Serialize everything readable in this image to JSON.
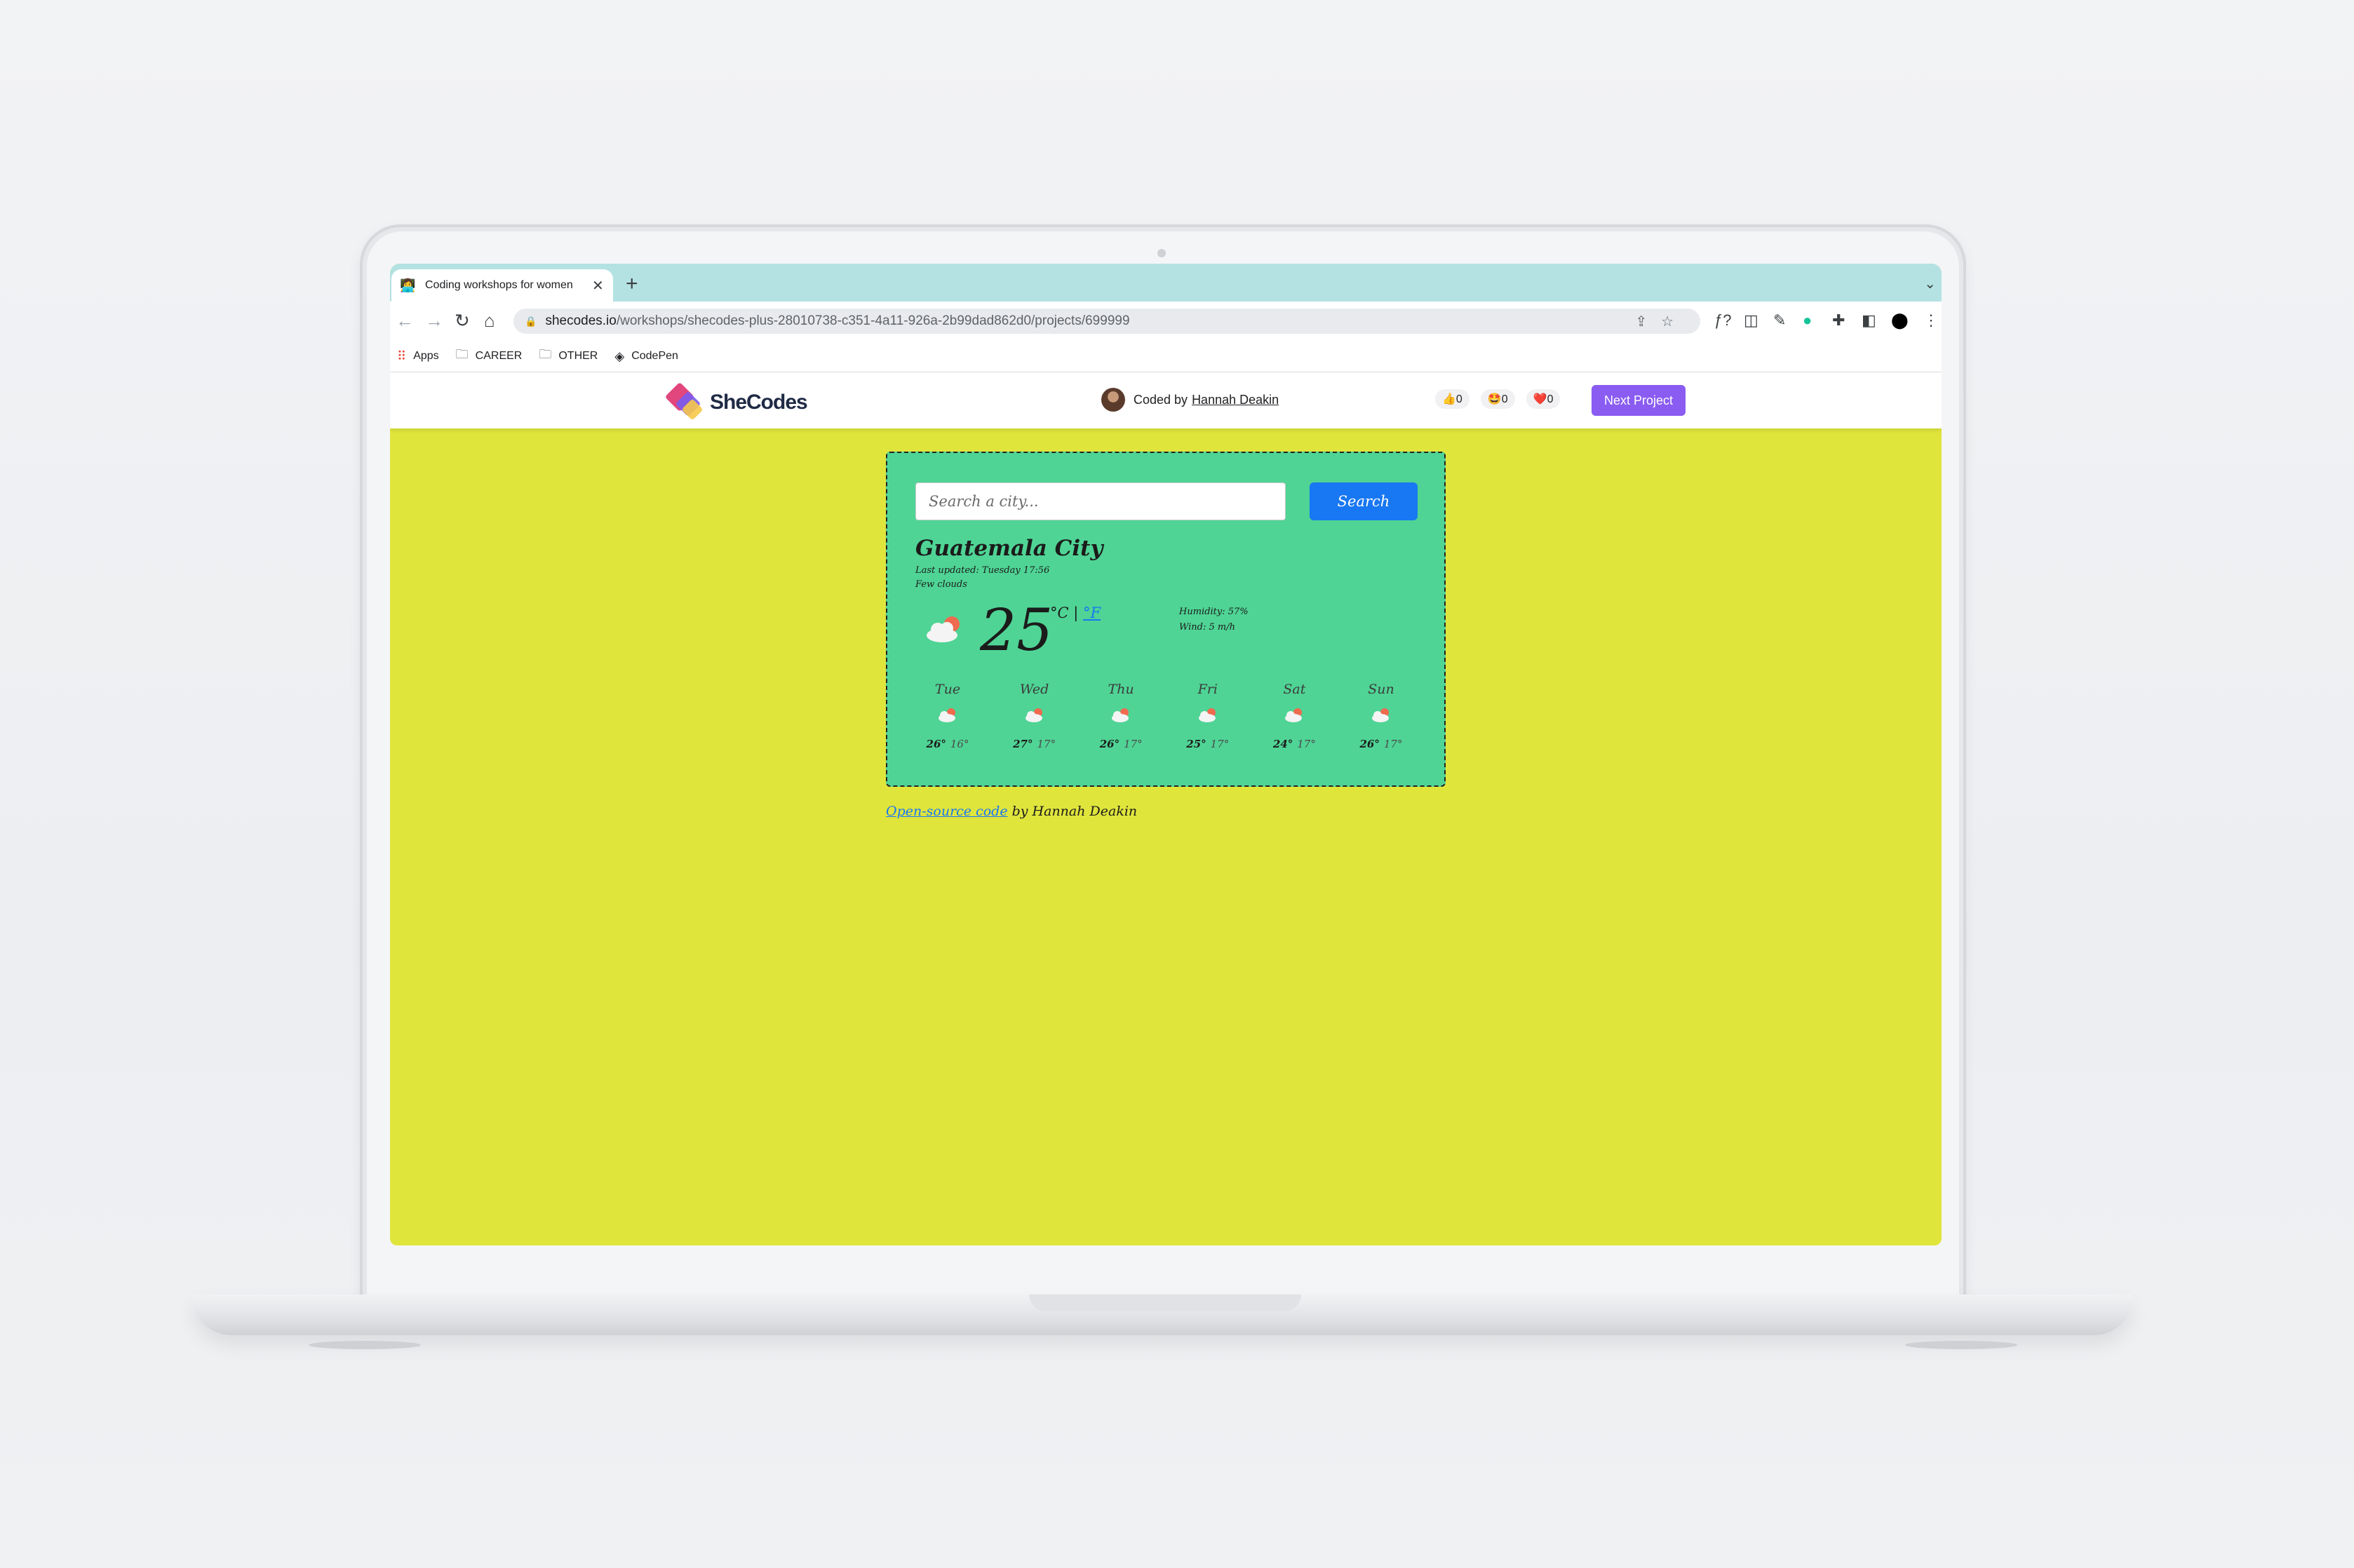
{
  "browser": {
    "tab_title": "Coding workshops for women",
    "url_domain": "shecodes.io",
    "url_path": "/workshops/shecodes-plus-28010738-c351-4a11-926a-2b99dad862d0/projects/699999",
    "bookmarks": [
      {
        "label": "Apps",
        "icon": "apps-grid-icon"
      },
      {
        "label": "CAREER",
        "icon": "folder-icon"
      },
      {
        "label": "OTHER",
        "icon": "folder-icon"
      },
      {
        "label": "CodePen",
        "icon": "codepen-icon"
      }
    ]
  },
  "header": {
    "logo_text": "SheCodes",
    "coded_by": "Coded by",
    "author": "Hannah Deakin",
    "reactions": [
      {
        "emoji": "👍",
        "count": "0"
      },
      {
        "emoji": "🤩",
        "count": "0"
      },
      {
        "emoji": "❤️",
        "count": "0"
      }
    ],
    "next_label": "Next Project"
  },
  "weather": {
    "search_placeholder": "Search a city...",
    "search_label": "Search",
    "city": "Guatemala City",
    "last_updated": "Last updated: Tuesday 17:56",
    "description": "Few clouds",
    "temperature": "25",
    "unit_c": "°C",
    "unit_sep": "|",
    "unit_f": "°F",
    "humidity": "Humidity: 57%",
    "wind": "Wind: 5 m/h",
    "forecast": [
      {
        "day": "Tue",
        "max": "26°",
        "min": "16°"
      },
      {
        "day": "Wed",
        "max": "27°",
        "min": "17°"
      },
      {
        "day": "Thu",
        "max": "26°",
        "min": "17°"
      },
      {
        "day": "Fri",
        "max": "25°",
        "min": "17°"
      },
      {
        "day": "Sat",
        "max": "24°",
        "min": "17°"
      },
      {
        "day": "Sun",
        "max": "26°",
        "min": "17°"
      }
    ]
  },
  "footer": {
    "link": "Open-source code",
    "by": "by Hannah Deakin"
  },
  "colors": {
    "page_bg": "#e0e53c",
    "card_bg": "#4fd495",
    "search_btn": "#1877f2",
    "next_btn": "#8a5cf1",
    "tab_strip": "#b4e2e3"
  }
}
